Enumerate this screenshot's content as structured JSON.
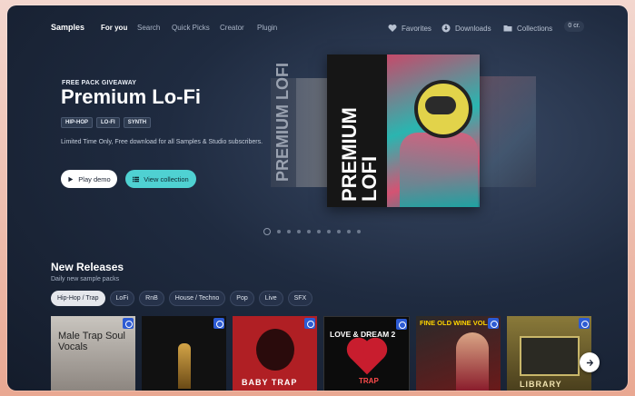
{
  "nav": {
    "brand": "Samples",
    "links": [
      "For you",
      "Search",
      "Quick Picks",
      "Creator",
      "Plugin"
    ],
    "favorites": "Favorites",
    "downloads": "Downloads",
    "collections": "Collections",
    "credits": "0 cr."
  },
  "hero": {
    "eyebrow": "FREE PACK GIVEAWAY",
    "title": "Premium Lo-Fi",
    "tags": [
      "HIP-HOP",
      "LO-FI",
      "SYNTH"
    ],
    "description": "Limited Time Only, Free download for all Samples & Studio subscribers.",
    "play_label": "Play demo",
    "view_label": "View collection",
    "art_text": "PREMIUM LOFI",
    "ghost_text": "PREMIUM LOFI"
  },
  "carousel": {
    "slides": 10,
    "active": 0
  },
  "releases": {
    "title": "New Releases",
    "subtitle": "Daily new sample packs",
    "filters": [
      "Hip-Hop / Trap",
      "LoFi",
      "RnB",
      "House / Techno",
      "Pop",
      "Live",
      "SFX"
    ],
    "active_filter": "Hip-Hop / Trap",
    "cards": [
      {
        "text": "Male Trap Soul Vocals"
      },
      {
        "text": ""
      },
      {
        "text": "BABY TRAP"
      },
      {
        "top": "LOVE & DREAM 2",
        "bottom": "TRAP"
      },
      {
        "text": "FINE OLD WINE VOL.3"
      },
      {
        "text": "LIBRARY"
      }
    ]
  }
}
